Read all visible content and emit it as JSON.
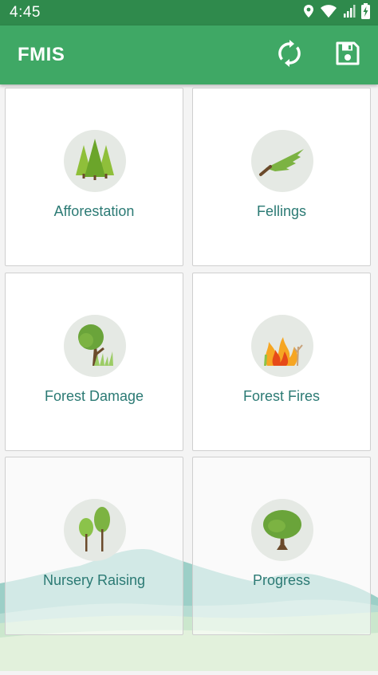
{
  "status_bar": {
    "time": "4:45",
    "icons": [
      "location-icon",
      "wifi-icon",
      "signal-icon",
      "battery-charging-icon"
    ]
  },
  "app_bar": {
    "title": "FMIS",
    "actions": [
      "sync-icon",
      "save-icon"
    ],
    "color": "#3fa865"
  },
  "menu": {
    "items": [
      {
        "label": "Afforestation",
        "icon": "pine-trees-icon"
      },
      {
        "label": "Fellings",
        "icon": "felled-tree-icon"
      },
      {
        "label": "Forest Damage",
        "icon": "damaged-tree-icon"
      },
      {
        "label": "Forest Fires",
        "icon": "forest-fire-icon"
      },
      {
        "label": "Nursery Raising",
        "icon": "saplings-icon"
      },
      {
        "label": "Progress",
        "icon": "grown-tree-icon"
      }
    ],
    "label_color": "#2b7a74"
  }
}
